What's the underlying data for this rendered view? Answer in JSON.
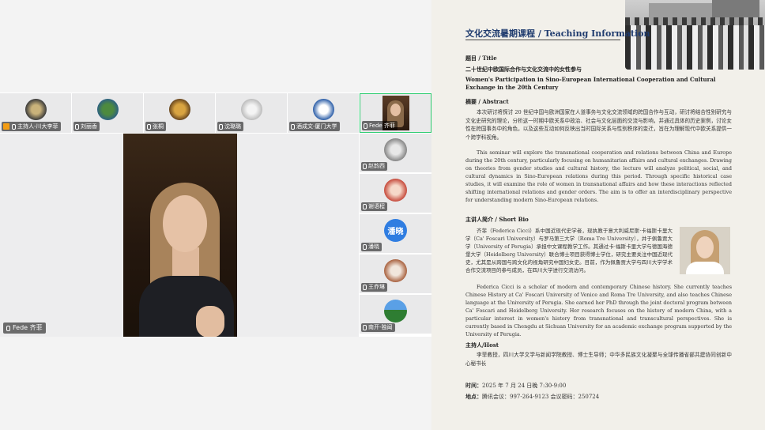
{
  "meeting": {
    "top_tiles": [
      {
        "name": "主持人-川大李菲",
        "host": true
      },
      {
        "name": "刘丽香"
      },
      {
        "name": "张桐"
      },
      {
        "name": "沈璐璐"
      },
      {
        "name": "酒成文-厦门大学"
      },
      {
        "name": "Fede 齐菲",
        "active": true
      }
    ],
    "main_speaker": "Fede 齐菲",
    "side_tiles": [
      {
        "name": "赵韵西"
      },
      {
        "name": "谢语程"
      },
      {
        "name": "潘晓",
        "avatar_text": "潘晓"
      },
      {
        "name": "王乔琳"
      },
      {
        "name": "南开-独闻"
      }
    ]
  },
  "poster": {
    "heading": "文化交流暑期课程 / Teaching Information",
    "title_label": "题目 / Title",
    "title_cn": "二十世纪中欧国际合作与文化交流中的女性参与",
    "title_en": "Women's Participation in Sino-European International Cooperation and Cultural Exchange in the 20th Century",
    "abstract_label": "摘要 / Abstract",
    "abstract_cn": "本次研讨将探讨 20 世纪中国与欧洲国家在人道事务与文化交流领域的跨国合作与互动，研讨将结合性别研究与文化史研究的理论，分析这一时期中欧关系中政治、社会与文化层面的交流与影响，并通过具体的历史案例，讨论女性在跨国事务中的角色，以及这些互动如何反映出当时国际关系与性别秩序的变迁，旨在为理解现代中欧关系提供一个跨学科视角。",
    "abstract_en": "This seminar will explore the transnational cooperation and relations between China and Europe during the 20th century, particularly focusing on humanitarian affairs and cultural exchanges. Drawing on theories from gender studies and cultural history, the lecture will analyze political, social, and cultural dynamics in Sino-European relations during this period. Through specific historical case studies, it will examine the role of women in transnational affairs and how these interactions reflected shifting international relations and gender orders. The aim is to offer an interdisciplinary perspective for understanding modern Sino-European relations.",
    "bio_label": "主讲人简介 / Short Bio",
    "bio_cn": "齐菲（Federica Cicci）系中国近现代史学者，现执教于意大利威尼斯·卡福斯卡里大学（Ca' Foscari University）与罗马第三大学（Roma Tre University），并于佩鲁贾大学（University of Perugia）承担中文课程教学工作。其通过卡·福斯卡里大学与德国海德堡大学（Heidelberg University）联合博士项目获得博士学位，研究主要关注中国近现代史，尤其是从跨国与跨文化的视角研究中国妇女史。目前，作为佩鲁贾大学与四川大学学术合作交流项目的参与成员，在四川大学进行交流访问。",
    "bio_en": "Federica Cicci is a scholar of modern and contemporary Chinese history. She currently teaches Chinese History at Ca' Foscari University of Venice and Roma Tre University, and also teaches Chinese language at the University of Perugia. She earned her PhD through the joint doctoral program between Ca' Foscari and Heidelberg University. Her research focuses on the history of modern China, with a particular interest in women's history from transnational and transcultural perspectives. She is currently based in Chengdu at Sichuan University for an academic exchange program supported by the University of Perugia.",
    "host_label": "主持人/Host",
    "host_text": "李菲教授，四川大学文学与新闻学院教授、博士生导师；中华多民族文化凝聚与全球传播省部共建协同创新中心秘书长",
    "time_label": "时间：",
    "time_value": "2025 年 7 月 24 日晚 7:30-9:00",
    "place_label": "地点：",
    "place_value": "腾讯会议：997-264-9123   会议密码：250724"
  }
}
